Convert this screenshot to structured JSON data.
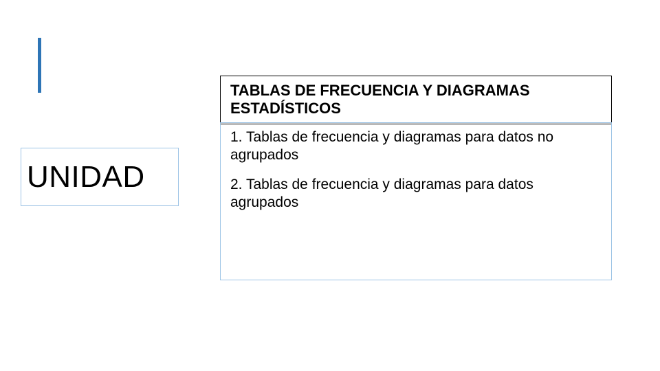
{
  "accent": {
    "color": "#2E75B6"
  },
  "unit": {
    "label": "UNIDAD"
  },
  "title": {
    "text": "TABLAS DE FRECUENCIA Y DIAGRAMAS ESTADÍSTICOS"
  },
  "content": {
    "item1": "1. Tablas de frecuencia y diagramas para datos no agrupados",
    "item2": "2. Tablas de frecuencia y diagramas para datos agrupados"
  }
}
